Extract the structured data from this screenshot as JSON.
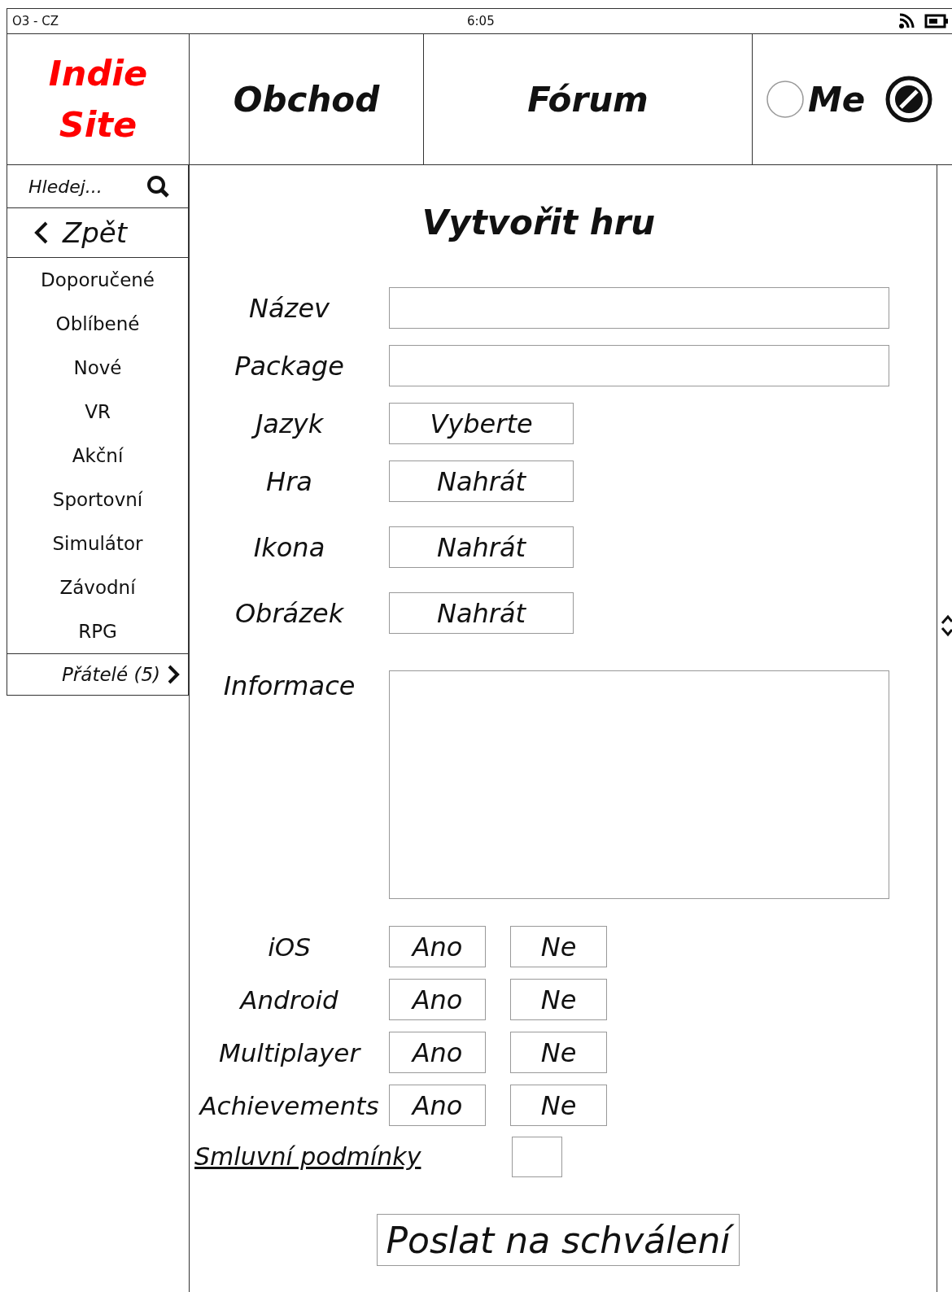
{
  "status_bar": {
    "carrier": "O3 - CZ",
    "time": "6:05"
  },
  "logo": {
    "line1": "Indie",
    "line2": "Site"
  },
  "nav": [
    {
      "label": "Obchod"
    },
    {
      "label": "Fórum"
    }
  ],
  "user": {
    "label": "Me"
  },
  "sidebar": {
    "search": {
      "placeholder": "Hledej..."
    },
    "back": "Zpět",
    "items": [
      {
        "label": "Doporučené"
      },
      {
        "label": "Oblíbené"
      },
      {
        "label": "Nové"
      },
      {
        "label": "VR"
      },
      {
        "label": "Akční"
      },
      {
        "label": "Sportovní"
      },
      {
        "label": "Simulátor"
      },
      {
        "label": "Závodní"
      },
      {
        "label": "RPG"
      }
    ],
    "friends": "Přátelé (5)"
  },
  "form": {
    "title": "Vytvořit hru",
    "fields": [
      {
        "kind": "text",
        "label": "Název"
      },
      {
        "kind": "text",
        "label": "Package"
      },
      {
        "kind": "select",
        "label": "Jazyk",
        "placeholder": "Vyberte"
      },
      {
        "kind": "upload",
        "label": "Hra",
        "button": "Nahrát"
      },
      {
        "kind": "upload",
        "label": "Ikona",
        "button": "Nahrát"
      },
      {
        "kind": "upload",
        "label": "Obrázek",
        "button": "Nahrát"
      },
      {
        "kind": "textarea",
        "label": "Informace"
      },
      {
        "kind": "yesno",
        "label": "iOS",
        "yes": "Ano",
        "no": "Ne"
      },
      {
        "kind": "yesno",
        "label": "Android",
        "yes": "Ano",
        "no": "Ne"
      },
      {
        "kind": "yesno",
        "label": "Multiplayer",
        "yes": "Ano",
        "no": "Ne"
      },
      {
        "kind": "yesno",
        "label": "Achievements",
        "yes": "Ano",
        "no": "Ne"
      },
      {
        "kind": "checkbox",
        "label": "Smluvní podmínky",
        "checked": false
      }
    ],
    "submit": "Poslat na schválení"
  }
}
